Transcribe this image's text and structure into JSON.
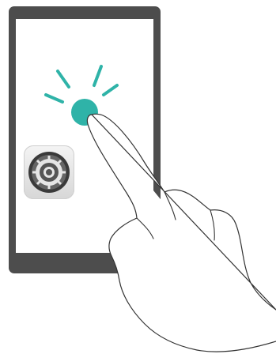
{
  "illustration": {
    "device": "tablet",
    "app_icon": "settings-gear-icon",
    "gesture": "single-tap",
    "colors": {
      "device_frame": "#4d4d4d",
      "screen": "#ffffff",
      "tap_indicator": "#2fb3a8",
      "hand_outline": "#333333"
    }
  }
}
